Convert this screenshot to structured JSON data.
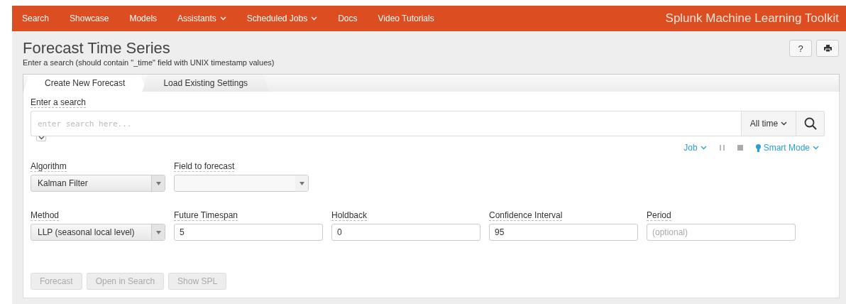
{
  "nav": {
    "items": [
      {
        "label": "Search",
        "dropdown": false
      },
      {
        "label": "Showcase",
        "dropdown": false
      },
      {
        "label": "Models",
        "dropdown": false
      },
      {
        "label": "Assistants",
        "dropdown": true
      },
      {
        "label": "Scheduled Jobs",
        "dropdown": true
      },
      {
        "label": "Docs",
        "dropdown": false
      },
      {
        "label": "Video Tutorials",
        "dropdown": false
      }
    ],
    "app_title": "Splunk Machine Learning Toolkit"
  },
  "page": {
    "title": "Forecast Time Series",
    "subtitle": "Enter a search (should contain \"_time\" field with UNIX timestamp values)",
    "help_button": "?"
  },
  "tabs": [
    {
      "label": "Create New Forecast",
      "selected": true
    },
    {
      "label": "Load Existing Settings",
      "selected": false
    }
  ],
  "search": {
    "label": "Enter a search",
    "placeholder": "enter search here...",
    "time_range": "All time",
    "job": "Job",
    "mode": "Smart Mode"
  },
  "rows": [
    [
      {
        "label": "Algorithm",
        "kind": "select",
        "value": "Kalman Filter"
      },
      {
        "label": "Field to forecast",
        "kind": "select"
      }
    ],
    [
      {
        "label": "Method",
        "kind": "select",
        "value": "LLP (seasonal local level)"
      },
      {
        "label": "Future Timespan",
        "kind": "input",
        "value": "5"
      },
      {
        "label": "Holdback",
        "kind": "input",
        "value": "0"
      },
      {
        "label": "Confidence Interval",
        "kind": "input",
        "value": "95"
      },
      {
        "label": "Period",
        "kind": "input",
        "placeholder": "(optional)"
      }
    ]
  ],
  "buttons": [
    {
      "label": "Forecast",
      "disabled": true
    },
    {
      "label": "Open in Search",
      "disabled": true
    },
    {
      "label": "Show SPL",
      "disabled": true
    }
  ]
}
